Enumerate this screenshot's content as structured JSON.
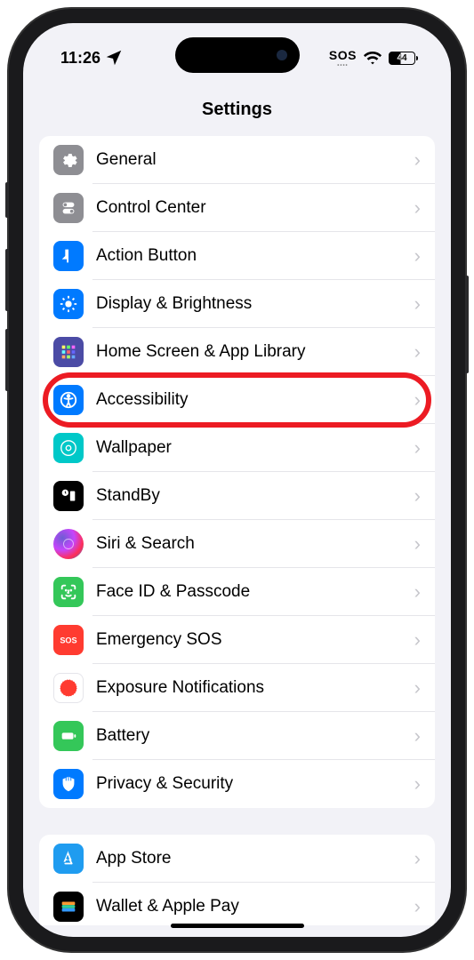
{
  "status": {
    "time": "11:26",
    "sos": "SOS",
    "battery": "44"
  },
  "header": {
    "title": "Settings"
  },
  "sections": [
    {
      "rows": [
        {
          "label": "General",
          "icon": "general"
        },
        {
          "label": "Control Center",
          "icon": "control"
        },
        {
          "label": "Action Button",
          "icon": "action"
        },
        {
          "label": "Display & Brightness",
          "icon": "display"
        },
        {
          "label": "Home Screen & App Library",
          "icon": "home"
        },
        {
          "label": "Accessibility",
          "icon": "access",
          "highlighted": true
        },
        {
          "label": "Wallpaper",
          "icon": "wallpaper"
        },
        {
          "label": "StandBy",
          "icon": "standby"
        },
        {
          "label": "Siri & Search",
          "icon": "siri"
        },
        {
          "label": "Face ID & Passcode",
          "icon": "faceid"
        },
        {
          "label": "Emergency SOS",
          "icon": "sos"
        },
        {
          "label": "Exposure Notifications",
          "icon": "exposure"
        },
        {
          "label": "Battery",
          "icon": "battery"
        },
        {
          "label": "Privacy & Security",
          "icon": "privacy"
        }
      ]
    },
    {
      "rows": [
        {
          "label": "App Store",
          "icon": "appstore"
        },
        {
          "label": "Wallet & Apple Pay",
          "icon": "wallet"
        }
      ]
    }
  ]
}
